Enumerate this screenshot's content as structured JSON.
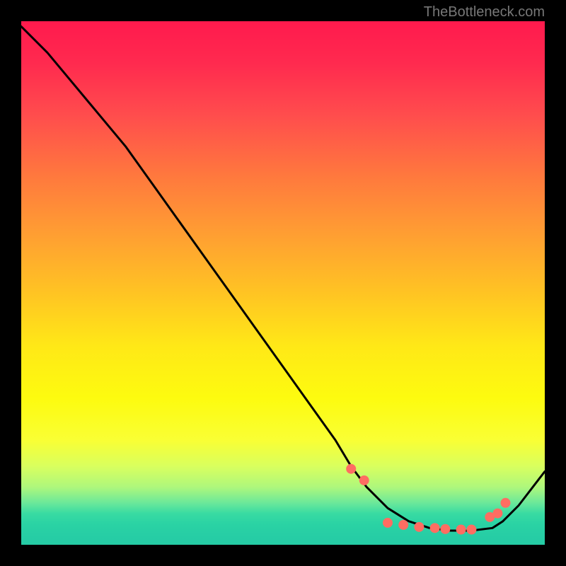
{
  "watermark": "TheBottleneck.com",
  "chart_data": {
    "type": "line",
    "title": "",
    "xlabel": "",
    "ylabel": "",
    "xlim": [
      0,
      100
    ],
    "ylim": [
      0,
      100
    ],
    "grid": false,
    "series": [
      {
        "name": "curve",
        "color": "#000000",
        "x": [
          0,
          5,
          10,
          15,
          20,
          25,
          30,
          35,
          40,
          45,
          50,
          55,
          60,
          63,
          66,
          70,
          74,
          78,
          82,
          86,
          90,
          92,
          95,
          100
        ],
        "y": [
          99,
          94,
          88,
          82,
          76,
          69,
          62,
          55,
          48,
          41,
          34,
          27,
          20,
          15,
          11,
          7,
          4.5,
          3.2,
          2.7,
          2.7,
          3.2,
          4.5,
          7.5,
          14
        ]
      }
    ],
    "markers": {
      "color": "#ff6d62",
      "radius": 7,
      "x": [
        63,
        65.5,
        70,
        73,
        76,
        79,
        81,
        84,
        86,
        89.5,
        91,
        92.5
      ],
      "y": [
        14.5,
        12.3,
        4.2,
        3.8,
        3.4,
        3.2,
        3.0,
        2.9,
        2.9,
        5.3,
        6.0,
        8.0
      ]
    }
  }
}
